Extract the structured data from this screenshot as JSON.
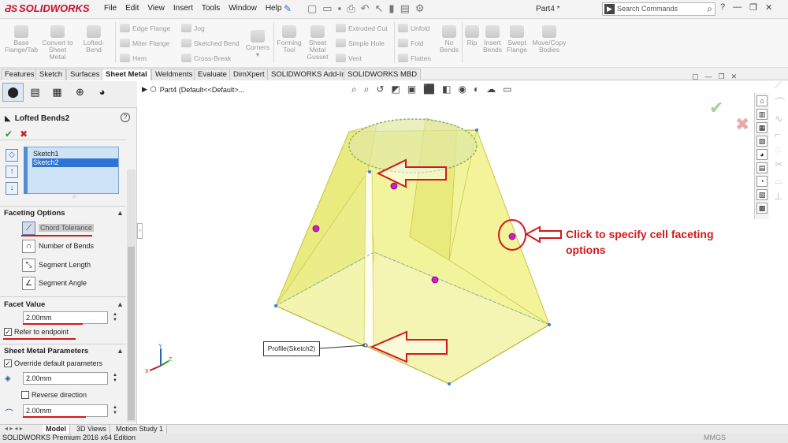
{
  "app": {
    "logo_text": "SOLIDWORKS",
    "menu": [
      "File",
      "Edit",
      "View",
      "Insert",
      "Tools",
      "Window",
      "Help"
    ],
    "document_title": "Part4 *",
    "search_placeholder": "Search Commands"
  },
  "ribbon": {
    "large_buttons": [
      {
        "label": "Base Flange/Tab"
      },
      {
        "label": "Convert to Sheet Metal"
      },
      {
        "label": "Lofted-Bend"
      },
      {
        "label": "Corners"
      },
      {
        "label": "Forming Tool"
      },
      {
        "label": "Sheet Metal Gusset"
      },
      {
        "label": "No Bends"
      },
      {
        "label": "Rip"
      },
      {
        "label": "Insert Bends"
      },
      {
        "label": "Swept Flange"
      },
      {
        "label": "Move/Copy Bodies"
      }
    ],
    "small_buttons": [
      "Edge Flange",
      "Miter Flange",
      "Hem",
      "Jog",
      "Sketched Bend",
      "Cross-Break",
      "Extruded Cut",
      "Simple Hole",
      "Vent",
      "Unfold",
      "Fold",
      "Flatten"
    ]
  },
  "tabs": [
    "Features",
    "Sketch",
    "Surfaces",
    "Sheet Metal",
    "Weldments",
    "Evaluate",
    "DimXpert",
    "SOLIDWORKS Add-Ins",
    "SOLIDWORKS MBD"
  ],
  "active_tab": "Sheet Metal",
  "property_manager": {
    "title": "Lofted Bends2",
    "profiles": [
      "Sketch1",
      "Sketch2"
    ],
    "selected_profile": "Sketch2",
    "faceting_options": {
      "header": "Faceting Options",
      "options": [
        "Chord Tolerance",
        "Number of Bends",
        "Segment Length",
        "Segment Angle"
      ],
      "selected": "Chord Tolerance"
    },
    "facet_value": {
      "header": "Facet Value",
      "value": "2.00mm",
      "refer_to_endpoint": "Refer to endpoint",
      "refer_checked": true
    },
    "sheet_metal_parameters": {
      "header": "Sheet Metal Parameters",
      "override_label": "Override default parameters",
      "override_checked": true,
      "thickness": "2.00mm",
      "reverse_direction": "Reverse direction",
      "reverse_checked": false,
      "bend_radius": "2.00mm"
    }
  },
  "graphics": {
    "tree_item": "Part4  (Default<<Default>...",
    "callout": "Click to specify cell faceting options",
    "profile_tag": "Profile(Sketch2)",
    "annotation_color": "#d21a1a"
  },
  "bottom_tabs": [
    "Model",
    "3D Views",
    "Motion Study 1"
  ],
  "active_bottom_tab": "Model",
  "status": {
    "left": "SOLIDWORKS Premium 2016 x64 Edition",
    "units": "MMGS"
  }
}
